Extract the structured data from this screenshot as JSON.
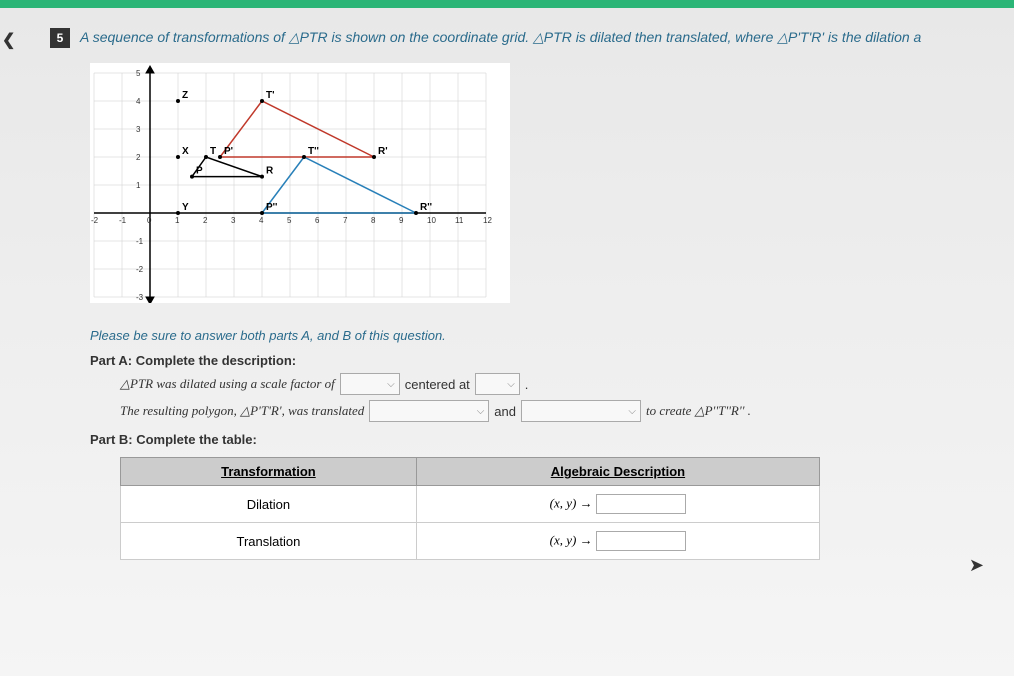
{
  "question": {
    "number": "5",
    "text": "A sequence of transformations of △PTR is shown on the coordinate grid. △PTR is dilated then translated, where △P'T'R' is the dilation a"
  },
  "chart_data": {
    "type": "scatter",
    "xlim": [
      -2,
      12
    ],
    "ylim": [
      -3,
      5
    ],
    "points_labeled": {
      "Z": [
        1,
        4
      ],
      "X": [
        1,
        2
      ],
      "Y": [
        1,
        0
      ],
      "P": [
        1.5,
        1.3
      ],
      "T": [
        2,
        2
      ],
      "R": [
        4,
        1.3
      ],
      "P'": [
        2.5,
        2
      ],
      "T'": [
        4,
        4
      ],
      "R'": [
        8,
        2
      ],
      "P''": [
        4,
        0
      ],
      "T''": [
        5.5,
        2
      ],
      "R''": [
        9.5,
        0
      ]
    },
    "triangles": [
      {
        "name": "PTR",
        "color": "#000",
        "vertices": [
          "P",
          "T",
          "R"
        ]
      },
      {
        "name": "P'T'R'",
        "color": "#c0392b",
        "vertices": [
          "P'",
          "T'",
          "R'"
        ]
      },
      {
        "name": "P''T''R''",
        "color": "#2980b9",
        "vertices": [
          "P''",
          "T''",
          "R''"
        ]
      }
    ],
    "x_ticks": [
      -2,
      -1,
      0,
      1,
      2,
      3,
      4,
      5,
      6,
      7,
      8,
      9,
      10,
      11,
      12
    ],
    "y_ticks": [
      -3,
      -2,
      -1,
      1,
      2,
      3,
      4,
      5
    ]
  },
  "instruction": "Please be sure to answer both parts A, and B of this question.",
  "partA": {
    "label": "Part A: Complete the description:",
    "line1_pre": "△PTR was dilated using a scale factor of",
    "line1_mid": "centered at",
    "line1_end": ".",
    "line2_pre": "The resulting polygon, △P'T'R', was translated",
    "line2_mid": "and",
    "line2_end": "to create △P''T''R'' ."
  },
  "partB": {
    "label": "Part B: Complete the table:",
    "headers": [
      "Transformation",
      "Algebraic Description"
    ],
    "rows": [
      {
        "name": "Dilation",
        "expr": "(x, y) →"
      },
      {
        "name": "Translation",
        "expr": "(x, y) →"
      }
    ]
  }
}
